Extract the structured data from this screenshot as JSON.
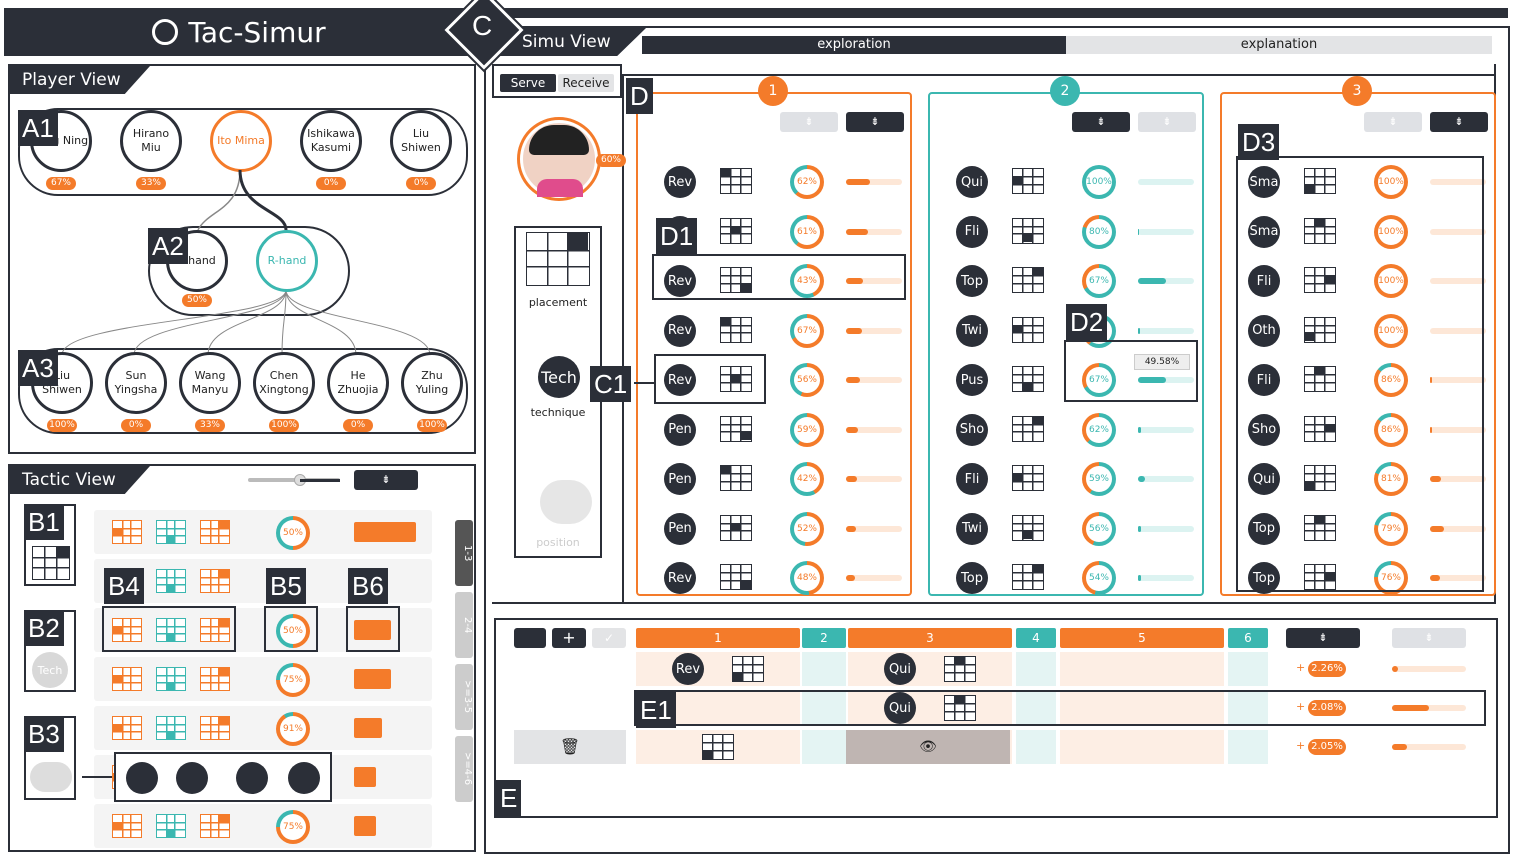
{
  "app": {
    "title": "Tac-Simur",
    "c_label": "C"
  },
  "player_view": {
    "title": "Player View",
    "top_players": [
      {
        "name": "Ding Ning",
        "pct": "67%"
      },
      {
        "name": "Hirano Miu",
        "pct": "33%"
      },
      {
        "name": "Ito Mima",
        "pct": ""
      },
      {
        "name": "Ishikawa Kasumi",
        "pct": "0%"
      },
      {
        "name": "Liu Shiwen",
        "pct": "0%"
      }
    ],
    "hand": [
      {
        "name": "L-hand",
        "pct": "50%"
      },
      {
        "name": "R-hand",
        "pct": ""
      }
    ],
    "bottom_players": [
      {
        "name": "Liu Shiwen",
        "pct": "100%"
      },
      {
        "name": "Sun Yingsha",
        "pct": "0%"
      },
      {
        "name": "Wang Manyu",
        "pct": "33%"
      },
      {
        "name": "Chen Xingtong",
        "pct": "100%"
      },
      {
        "name": "He Zhuojia",
        "pct": "0%"
      },
      {
        "name": "Zhu Yuling",
        "pct": "100%"
      }
    ],
    "tags": [
      "A1",
      "A2",
      "A3"
    ]
  },
  "tactic_view": {
    "title": "Tactic View",
    "tags": [
      "B1",
      "B2",
      "B3",
      "B4",
      "B5",
      "B6"
    ],
    "b2_label": "Tech",
    "rows": [
      {
        "pct": "50%",
        "bar": 1.0
      },
      {
        "pct": "",
        "bar": 0.0
      },
      {
        "pct": "50%",
        "bar": 0.6
      },
      {
        "pct": "75%",
        "bar": 0.6
      },
      {
        "pct": "91%",
        "bar": 0.45
      },
      {
        "pct": "",
        "bar": 0.35
      },
      {
        "pct": "75%",
        "bar": 0.35
      }
    ],
    "range_tabs": [
      "1-3",
      "2-4",
      ">=3-5",
      ">=4-6"
    ]
  },
  "simu_view": {
    "title": "Simu View",
    "tabs": [
      "exploration",
      "explanation"
    ],
    "serve_tabs": [
      "Serve",
      "Receive"
    ],
    "player_pct": "60%",
    "attrs": [
      "placement",
      "technique",
      "position"
    ],
    "tech_label": "Tech",
    "tags": {
      "D": "D",
      "D1": "D1",
      "D2": "D2",
      "D3": "D3",
      "C1": "C1",
      "E": "E",
      "E1": "E1"
    },
    "d2_tooltip": "49.58%",
    "columns": [
      {
        "num": "1",
        "color": "#f47b2a",
        "rows": [
          {
            "tech": "Rev",
            "pct": "62%",
            "v": 0.42
          },
          {
            "tech": "Rev",
            "pct": "61%",
            "v": 0.4
          },
          {
            "tech": "Rev",
            "pct": "43%",
            "v": 0.3
          },
          {
            "tech": "Rev",
            "pct": "67%",
            "v": 0.28
          },
          {
            "tech": "Rev",
            "pct": "56%",
            "v": 0.25
          },
          {
            "tech": "Pen",
            "pct": "59%",
            "v": 0.22
          },
          {
            "tech": "Pen",
            "pct": "42%",
            "v": 0.2
          },
          {
            "tech": "Pen",
            "pct": "52%",
            "v": 0.18
          },
          {
            "tech": "Rev",
            "pct": "48%",
            "v": 0.16
          }
        ]
      },
      {
        "num": "2",
        "color": "#3bb7b0",
        "rows": [
          {
            "tech": "Qui",
            "pct": "100%",
            "v": 0.0
          },
          {
            "tech": "Fli",
            "pct": "80%",
            "v": 0.02
          },
          {
            "tech": "Top",
            "pct": "67%",
            "v": 0.5
          },
          {
            "tech": "Twi",
            "pct": "",
            "v": 0.03
          },
          {
            "tech": "Pus",
            "pct": "67%",
            "v": 0.5
          },
          {
            "tech": "Sho",
            "pct": "62%",
            "v": 0.06
          },
          {
            "tech": "Fli",
            "pct": "59%",
            "v": 0.12
          },
          {
            "tech": "Twi",
            "pct": "56%",
            "v": 0.06
          },
          {
            "tech": "Top",
            "pct": "54%",
            "v": 0.06
          }
        ]
      },
      {
        "num": "3",
        "color": "#f47b2a",
        "rows": [
          {
            "tech": "Sma",
            "pct": "100%",
            "v": 0.0
          },
          {
            "tech": "Sma",
            "pct": "100%",
            "v": 0.0
          },
          {
            "tech": "Fli",
            "pct": "100%",
            "v": 0.0
          },
          {
            "tech": "Oth",
            "pct": "100%",
            "v": 0.0
          },
          {
            "tech": "Fli",
            "pct": "86%",
            "v": 0.04
          },
          {
            "tech": "Sho",
            "pct": "86%",
            "v": 0.04
          },
          {
            "tech": "Qui",
            "pct": "81%",
            "v": 0.2
          },
          {
            "tech": "Top",
            "pct": "79%",
            "v": 0.25
          },
          {
            "tech": "Top",
            "pct": "76%",
            "v": 0.18
          }
        ]
      }
    ],
    "explanation": {
      "headers": [
        "1",
        "2",
        "3",
        "4",
        "5",
        "6"
      ],
      "rows": [
        {
          "a": "Rev",
          "c": "Qui",
          "pct": "2.26%",
          "v": 0.08
        },
        {
          "a": "",
          "c": "Qui",
          "pct": "2.08%",
          "v": 0.5
        },
        {
          "a": "",
          "c": "",
          "pct": "2.05%",
          "v": 0.2
        }
      ],
      "plus": "+"
    }
  }
}
